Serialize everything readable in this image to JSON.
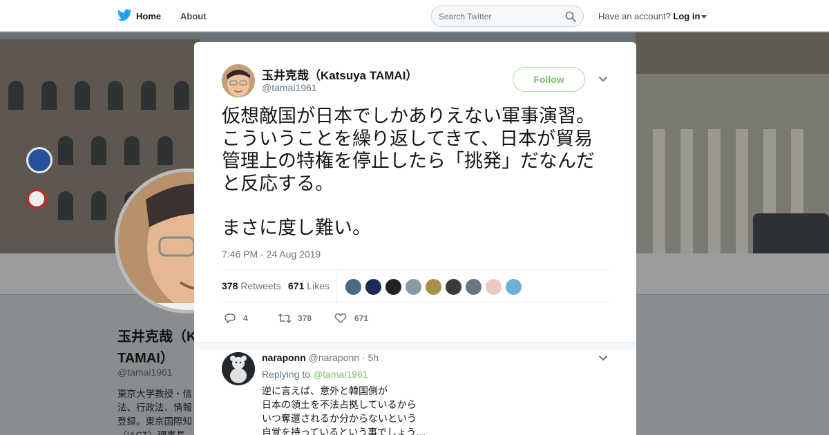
{
  "topbar": {
    "nav_home": "Home",
    "nav_about": "About",
    "search_placeholder": "Search Twitter",
    "have_account": "Have an account?",
    "login": "Log in"
  },
  "profile": {
    "name_line1": "玉井克哉（K",
    "name_line2": "TAMAI）",
    "handle": "@tamai1961",
    "bio_lines": [
      "東京大学教授・信",
      "法、行政法、情報",
      "登録。東京国際知",
      "（IACT）理事長"
    ]
  },
  "tweet": {
    "author_name": "玉井克哉（Katsuya TAMAI）",
    "author_handle": "@tamai1961",
    "follow_label": "Follow",
    "text_para1": "仮想敵国が日本でしかありえない軍事演習。こういうことを繰り返してきて、日本が貿易管理上の特権を停止したら「挑発」だなんだと反応する。",
    "text_para2": "まさに度し難い。",
    "timestamp": "7:46 PM - 24 Aug 2019",
    "retweets_count": "378",
    "retweets_label": "Retweets",
    "likes_count": "671",
    "likes_label": "Likes",
    "liker_colors": [
      "#4a6a86",
      "#1c2a55",
      "#222222",
      "#8a9aa3",
      "#a8904a",
      "#3b3a40",
      "#6b7480",
      "#e9c9c1",
      "#6fb0d4"
    ],
    "actions": {
      "reply_count": "4",
      "retweet_count": "378",
      "like_count": "671"
    }
  },
  "reply": {
    "name": "naraponn",
    "handle": "@naraponn",
    "time": "· 5h",
    "replying_to_label": "Replying to",
    "replying_to_handle": "@tamai1961",
    "lines": [
      "逆に言えば、意外と韓国側が",
      "日本の領土を不法占拠しているから",
      "いつ奪還されるか分からないという",
      "自覚を持っているという事でしょう…"
    ]
  },
  "colors": {
    "brand_green": "#79c16a",
    "twitter_blue": "#1da1f2"
  },
  "icons": [
    "twitter-bird-icon",
    "search-icon",
    "close-icon",
    "chevron-down-icon",
    "reply-icon",
    "retweet-icon",
    "heart-icon"
  ]
}
